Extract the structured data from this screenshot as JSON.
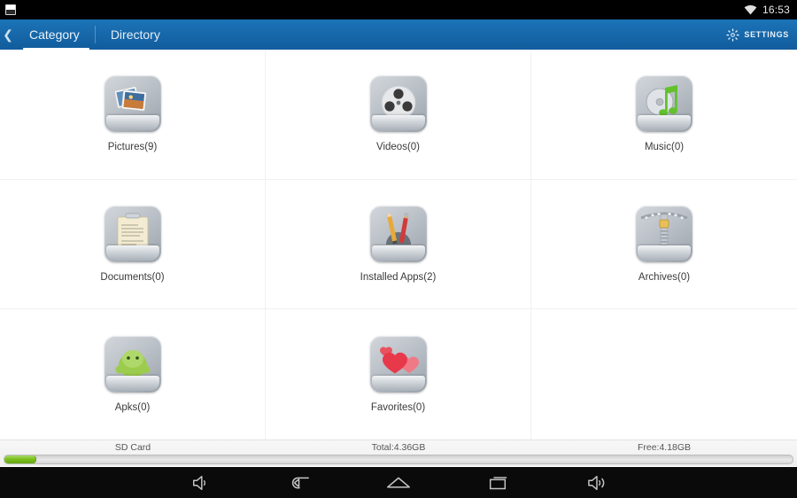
{
  "status_bar": {
    "notification_icon": "screenshot-icon",
    "wifi_icon": "wifi-icon",
    "time": "16:53"
  },
  "action_bar": {
    "back_icon": "chevron-left-icon",
    "tabs": [
      {
        "label": "Category",
        "active": true
      },
      {
        "label": "Directory",
        "active": false
      }
    ],
    "settings": {
      "icon": "gear-icon",
      "label": "SETTINGS"
    },
    "colors": {
      "bar_top": "#1b74b8",
      "bar_bottom": "#115c9c",
      "active_tab_underline": "#ffffff"
    }
  },
  "categories": [
    {
      "label": "Pictures(9)",
      "icon": "pictures-icon",
      "name": "Pictures",
      "count": 9
    },
    {
      "label": "Videos(0)",
      "icon": "videos-icon",
      "name": "Videos",
      "count": 0
    },
    {
      "label": "Music(0)",
      "icon": "music-icon",
      "name": "Music",
      "count": 0
    },
    {
      "label": "Documents(0)",
      "icon": "documents-icon",
      "name": "Documents",
      "count": 0
    },
    {
      "label": "Installed Apps(2)",
      "icon": "installed-apps-icon",
      "name": "Installed Apps",
      "count": 2
    },
    {
      "label": "Archives(0)",
      "icon": "archives-icon",
      "name": "Archives",
      "count": 0
    },
    {
      "label": "Apks(0)",
      "icon": "apks-icon",
      "name": "Apks",
      "count": 0
    },
    {
      "label": "Favorites(0)",
      "icon": "favorites-icon",
      "name": "Favorites",
      "count": 0
    }
  ],
  "storage": {
    "device_label": "SD Card",
    "total_label": "Total:4.36GB",
    "free_label": "Free:4.18GB",
    "used_percent": 4,
    "fill_color": "#7cc01f"
  },
  "nav_bar": {
    "buttons": [
      {
        "icon": "volume-down-icon"
      },
      {
        "icon": "back-icon"
      },
      {
        "icon": "home-icon"
      },
      {
        "icon": "recents-icon"
      },
      {
        "icon": "volume-up-icon"
      }
    ]
  }
}
